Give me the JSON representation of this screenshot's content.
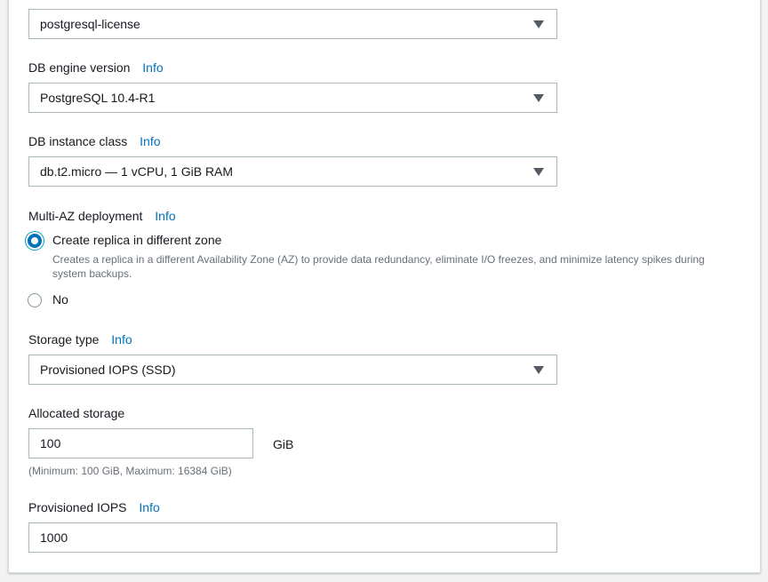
{
  "license_model": {
    "value": "postgresql-license"
  },
  "engine_version": {
    "label": "DB engine version",
    "info": "Info",
    "value": "PostgreSQL 10.4-R1"
  },
  "instance_class": {
    "label": "DB instance class",
    "info": "Info",
    "value": "db.t2.micro — 1 vCPU, 1 GiB RAM"
  },
  "multi_az": {
    "label": "Multi-AZ deployment",
    "info": "Info",
    "options": [
      {
        "label": "Create replica in different zone",
        "description": "Creates a replica in a different Availability Zone (AZ) to provide data redundancy, eliminate I/O freezes, and minimize latency spikes during system backups.",
        "selected": true
      },
      {
        "label": "No",
        "selected": false
      }
    ]
  },
  "storage_type": {
    "label": "Storage type",
    "info": "Info",
    "value": "Provisioned IOPS (SSD)"
  },
  "allocated_storage": {
    "label": "Allocated storage",
    "value": "100",
    "unit": "GiB",
    "hint": "(Minimum: 100 GiB, Maximum: 16384 GiB)"
  },
  "provisioned_iops": {
    "label": "Provisioned IOPS",
    "info": "Info",
    "value": "1000"
  },
  "colors": {
    "link": "#0073bb",
    "border": "#aab7b8",
    "text": "#16191f",
    "muted": "#687078",
    "radio_selected": "#0073bb"
  }
}
